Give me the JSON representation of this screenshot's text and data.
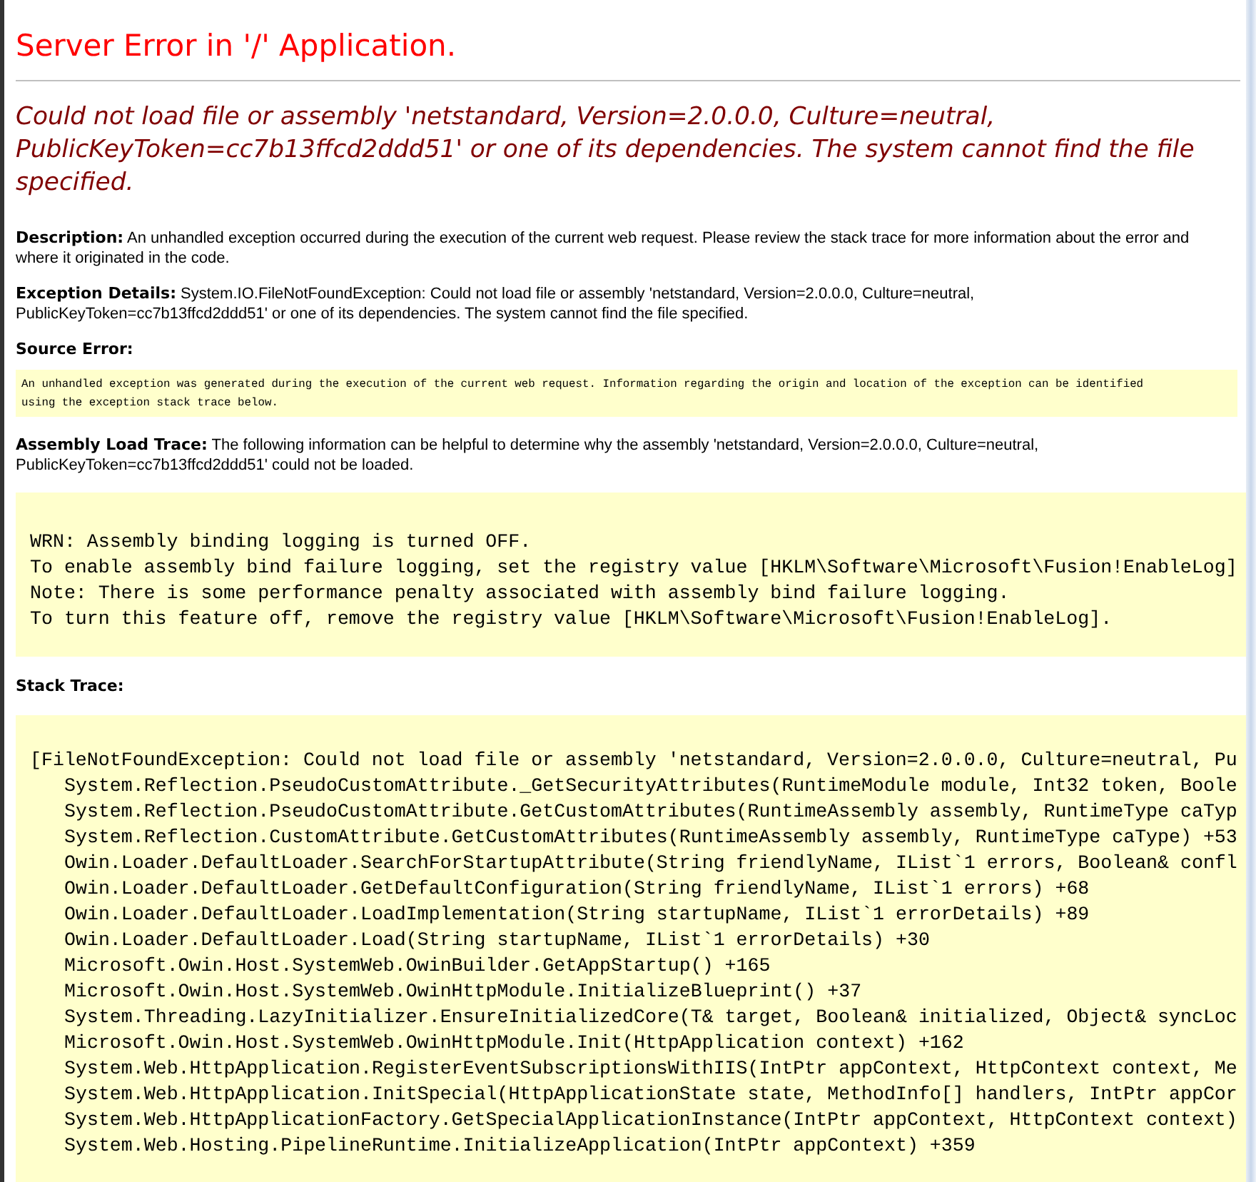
{
  "title": "Server Error in '/' Application.",
  "error_message": "Could not load file or assembly 'netstandard, Version=2.0.0.0, Culture=neutral, PublicKeyToken=cc7b13ffcd2ddd51' or one of its dependencies. The system cannot find the file specified.",
  "description": "**Description:** An unhandled exception occurred during the execution of the current web request. Please review the stack trace for more information about the error and where it originated in the code.",
  "exception_details": "**Exception Details:** System.IO.FileNotFoundException: Could not load file or assembly 'netstandard, Version=2.0.0.0, Culture=neutral, PublicKeyToken=cc7b13ffcd2ddd51' or one of its dependencies. The system cannot find the file specified.",
  "source_error": {
    "label": "Source Error:",
    "lines": [
      "An unhandled exception was generated during the execution of the current web request. Information regarding the origin and location of the exception can be identified",
      "using the exception stack trace below."
    ]
  },
  "assembly_load_trace": {
    "text": "**Assembly Load Trace:** The following information can be helpful to determine why the assembly 'netstandard, Version=2.0.0.0, Culture=neutral, PublicKeyToken=cc7b13ffcd2ddd51' could not be loaded.",
    "lines": [
      "WRN: Assembly binding logging is turned OFF.",
      "To enable assembly bind failure logging, set the registry value [HKLM\\Software\\Microsoft\\Fusion!EnableLog]",
      "Note: There is some performance penalty associated with assembly bind failure logging.",
      "To turn this feature off, remove the registry value [HKLM\\Software\\Microsoft\\Fusion!EnableLog]."
    ]
  },
  "stack_trace": {
    "label": "Stack Trace:",
    "lines": [
      {
        "kind": "exception",
        "text": "[FileNotFoundException: Could not load file or assembly 'netstandard, Version=2.0.0.0, Culture=neutral, Pu"
      },
      {
        "kind": "frame",
        "text": "System.Reflection.PseudoCustomAttribute._GetSecurityAttributes(RuntimeModule module, Int32 token, Boole"
      },
      {
        "kind": "frame",
        "text": "System.Reflection.PseudoCustomAttribute.GetCustomAttributes(RuntimeAssembly assembly, RuntimeType caTyp"
      },
      {
        "kind": "frame",
        "text": "System.Reflection.CustomAttribute.GetCustomAttributes(RuntimeAssembly assembly, RuntimeType caType) +53"
      },
      {
        "kind": "frame",
        "text": "Owin.Loader.DefaultLoader.SearchForStartupAttribute(String friendlyName, IList`1 errors, Boolean& confl"
      },
      {
        "kind": "frame",
        "text": "Owin.Loader.DefaultLoader.GetDefaultConfiguration(String friendlyName, IList`1 errors) +68"
      },
      {
        "kind": "frame",
        "text": "Owin.Loader.DefaultLoader.LoadImplementation(String startupName, IList`1 errorDetails) +89"
      },
      {
        "kind": "frame",
        "text": "Owin.Loader.DefaultLoader.Load(String startupName, IList`1 errorDetails) +30"
      },
      {
        "kind": "frame",
        "text": "Microsoft.Owin.Host.SystemWeb.OwinBuilder.GetAppStartup() +165"
      },
      {
        "kind": "frame",
        "text": "Microsoft.Owin.Host.SystemWeb.OwinHttpModule.InitializeBlueprint() +37"
      },
      {
        "kind": "frame",
        "text": "System.Threading.LazyInitializer.EnsureInitializedCore(T& target, Boolean& initialized, Object& syncLoc"
      },
      {
        "kind": "frame",
        "text": "Microsoft.Owin.Host.SystemWeb.OwinHttpModule.Init(HttpApplication context) +162"
      },
      {
        "kind": "frame",
        "text": "System.Web.HttpApplication.RegisterEventSubscriptionsWithIIS(IntPtr appContext, HttpContext context, Me"
      },
      {
        "kind": "frame",
        "text": "System.Web.HttpApplication.InitSpecial(HttpApplicationState state, MethodInfo[] handlers, IntPtr appCor"
      },
      {
        "kind": "frame",
        "text": "System.Web.HttpApplicationFactory.GetSpecialApplicationInstance(IntPtr appContext, HttpContext context)"
      },
      {
        "kind": "frame",
        "text": "System.Web.Hosting.PipelineRuntime.InitializeApplication(IntPtr appContext) +359"
      }
    ]
  }
}
